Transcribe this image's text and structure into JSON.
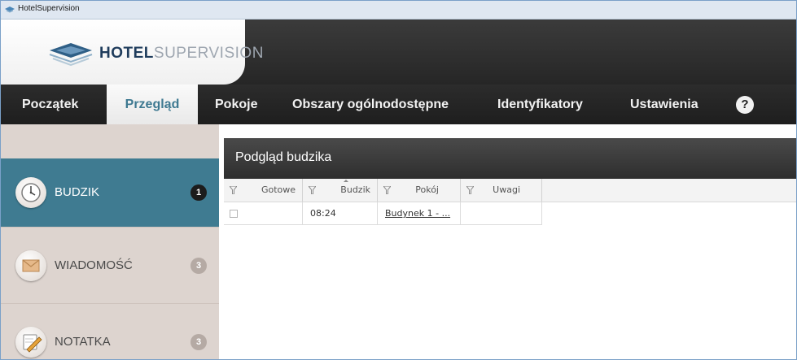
{
  "window": {
    "title": "HotelSupervision"
  },
  "logo": {
    "part1": "HOTEL",
    "part2": "SUPERVISION"
  },
  "nav": {
    "items": [
      {
        "label": "Początek",
        "active": false
      },
      {
        "label": "Przegląd",
        "active": true
      },
      {
        "label": "Pokoje",
        "active": false
      },
      {
        "label": "Obszary ogólnodostępne",
        "active": false
      },
      {
        "label": "Identyfikatory",
        "active": false
      },
      {
        "label": "Ustawienia",
        "active": false
      }
    ],
    "help_label": "?"
  },
  "sidebar": {
    "items": [
      {
        "label": "BUDZIK",
        "count": "1",
        "icon": "alarm-clock-icon",
        "active": true
      },
      {
        "label": "WIADOMOŚĆ",
        "count": "3",
        "icon": "envelope-icon",
        "active": false
      },
      {
        "label": "NOTATKA",
        "count": "3",
        "icon": "note-pencil-icon",
        "active": false
      }
    ]
  },
  "content": {
    "title": "Podgląd budzika",
    "columns": [
      "Gotowe",
      "Budzik",
      "Pokój",
      "Uwagi"
    ],
    "rows": [
      {
        "done": false,
        "alarm": "08:24",
        "room": "Budynek 1 - ...",
        "notes": ""
      }
    ]
  },
  "colors": {
    "accent": "#3f7b91",
    "nav_bg": "#262626",
    "sidebar_bg": "#ddd4cf",
    "badge_dark": "#1c1c1c",
    "badge_light": "#b5aaa4"
  }
}
